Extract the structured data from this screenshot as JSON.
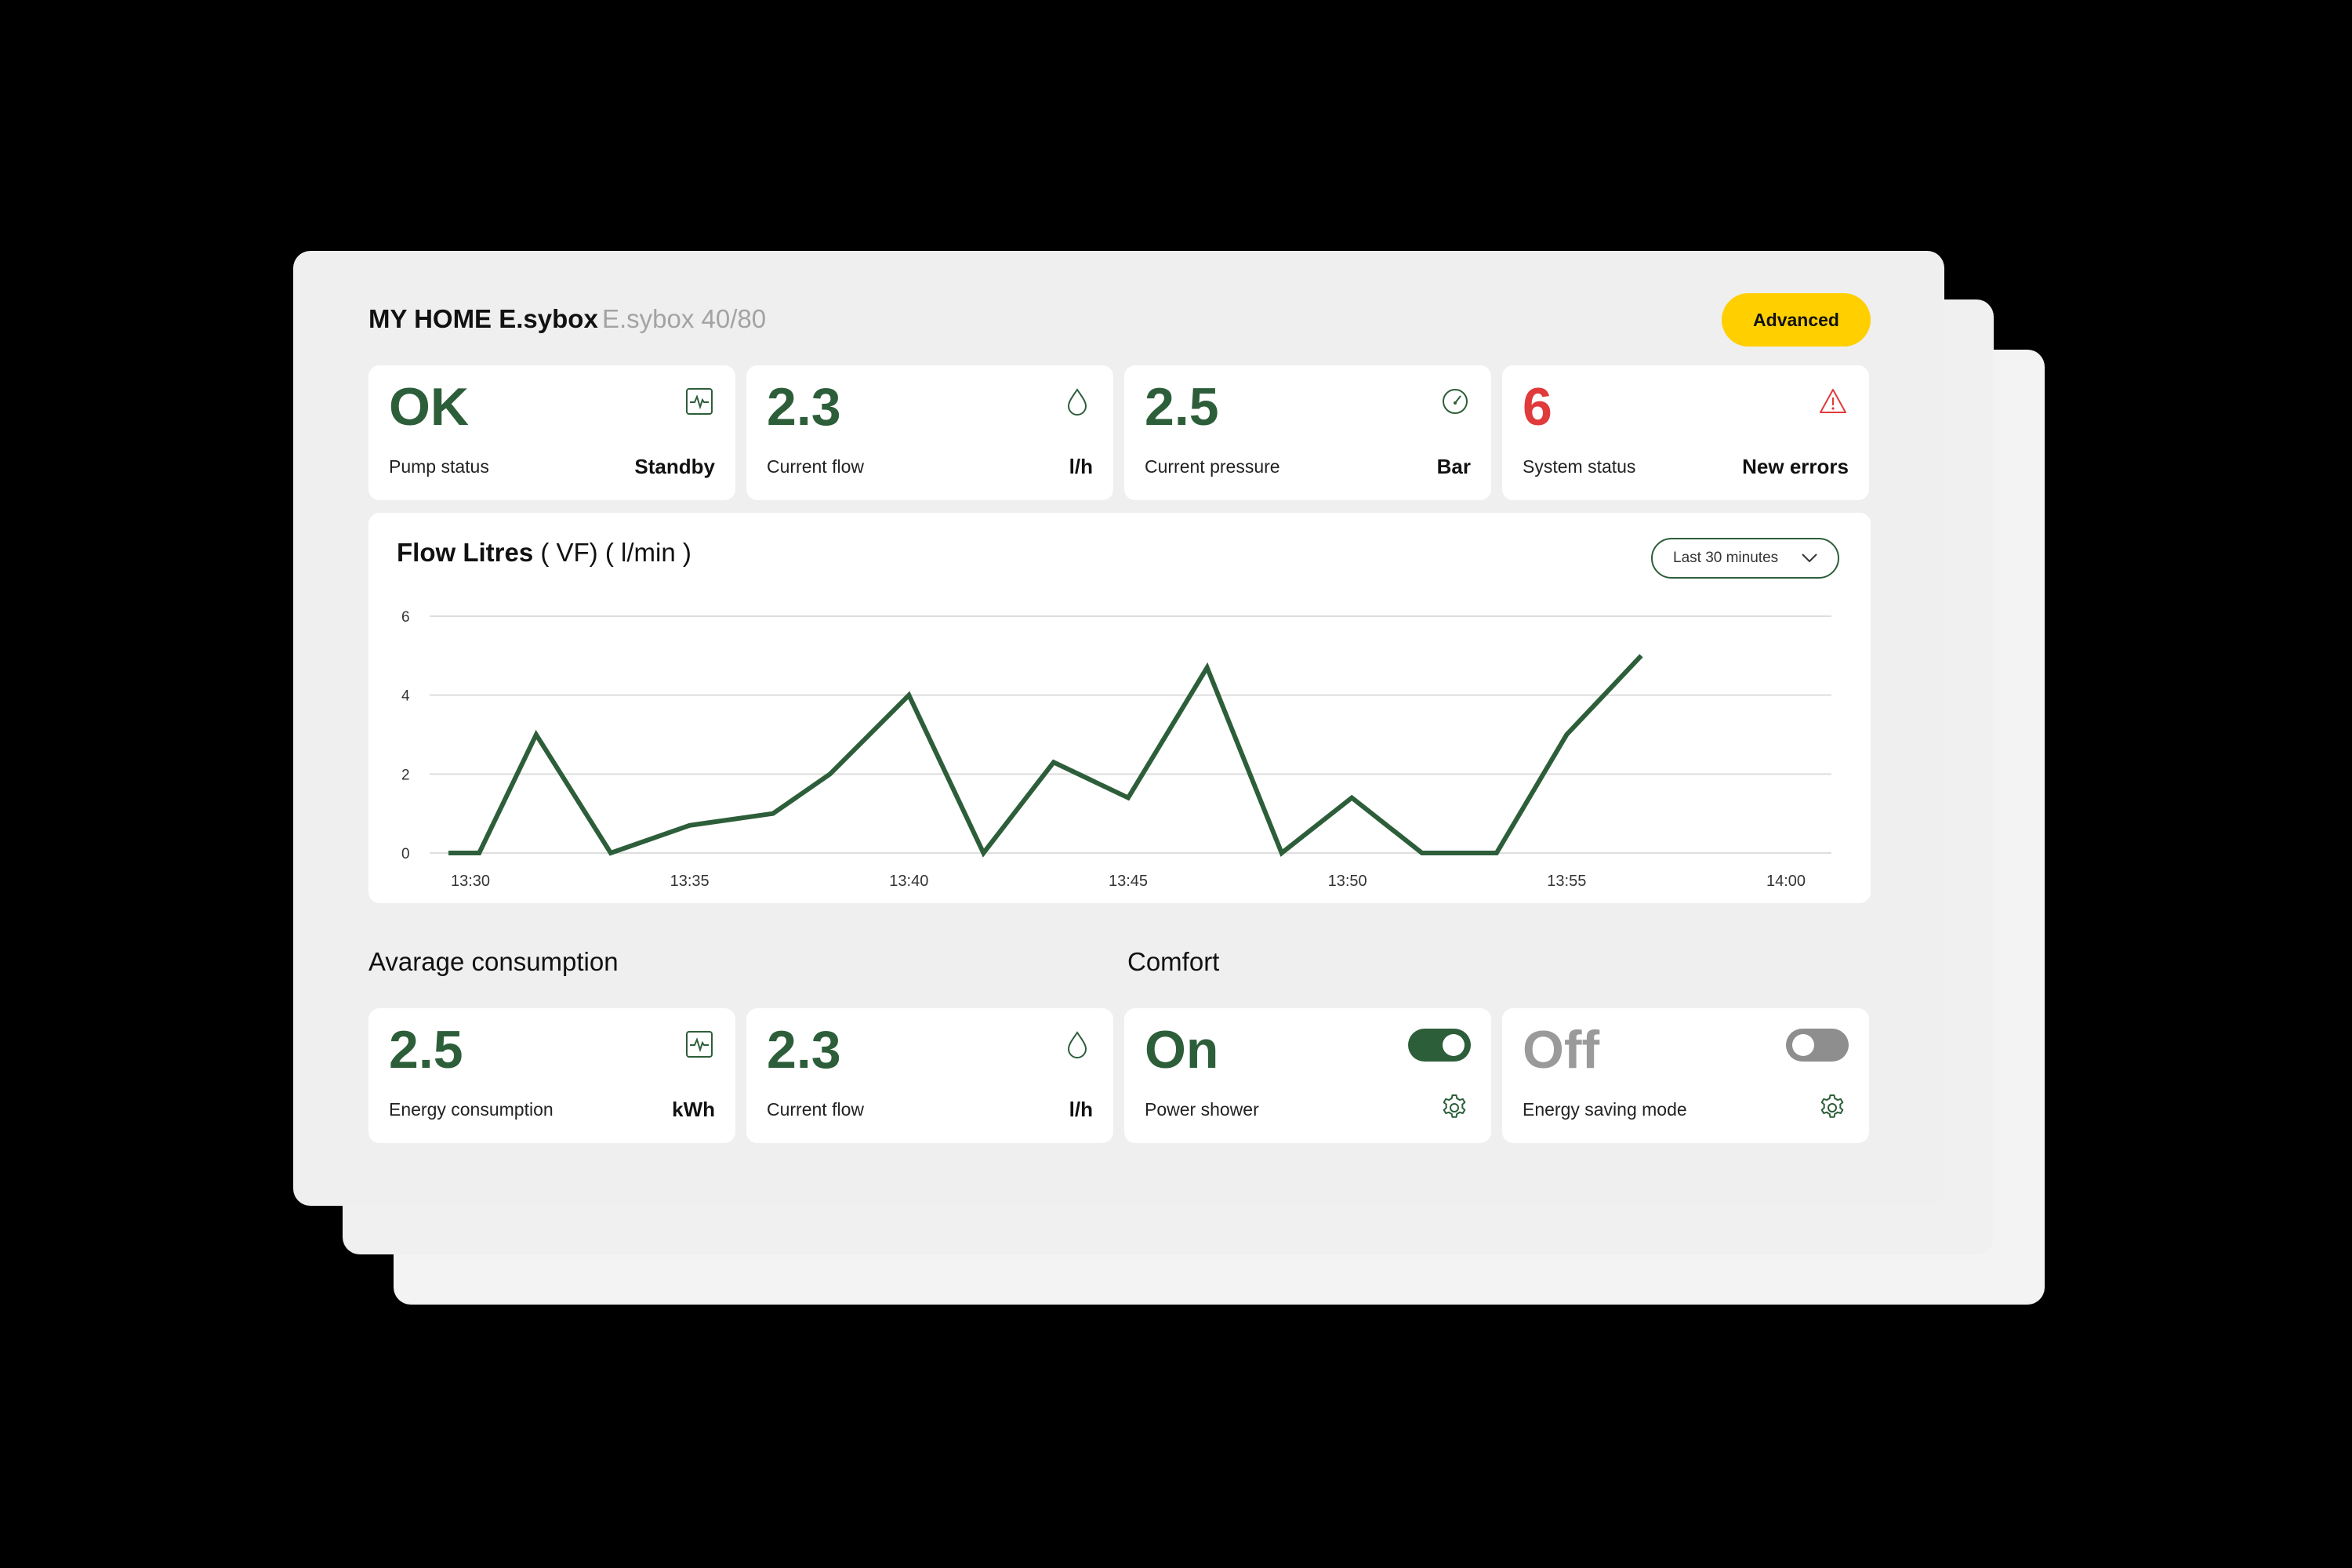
{
  "header": {
    "title": "MY HOME E.sybox",
    "subtitle": "E.sybox 40/80",
    "advanced_label": "Advanced"
  },
  "status_cards": [
    {
      "value": "OK",
      "label": "Pump status",
      "unit": "Standby",
      "icon": "activity-icon"
    },
    {
      "value": "2.3",
      "label": "Current flow",
      "unit": "l/h",
      "icon": "drop-icon"
    },
    {
      "value": "2.5",
      "label": "Current pressure",
      "unit": "Bar",
      "icon": "gauge-icon"
    },
    {
      "value": "6",
      "label": "System status",
      "unit": "New errors",
      "icon": "warning-icon"
    }
  ],
  "chart": {
    "title_bold": "Flow Litres",
    "title_rest": " ( VF) ( l/min )",
    "range_label": "Last 30 minutes"
  },
  "chart_data": {
    "type": "line",
    "title": "Flow Litres ( VF) ( l/min )",
    "x_ticks": [
      "13:30",
      "13:35",
      "13:40",
      "13:45",
      "13:50",
      "13:55",
      "14:00"
    ],
    "y_ticks": [
      "0",
      "2",
      "4",
      "6"
    ],
    "ylim": [
      0,
      6
    ],
    "xlim": [
      "13:30",
      "14:00"
    ],
    "grid": true,
    "series": [
      {
        "color": "#2d5e3a",
        "x": [
          "13:29.5",
          "13:30.2",
          "13:31.5",
          "13:33.2",
          "13:35",
          "13:36.9",
          "13:38.2",
          "13:40",
          "13:41.7",
          "13:43.3",
          "13:45",
          "13:46.8",
          "13:48.5",
          "13:50.1",
          "13:51.7",
          "13:53.4",
          "13:55",
          "13:56.7"
        ],
        "y": [
          0,
          0,
          3.0,
          0,
          0.7,
          1.0,
          2.0,
          4.0,
          0,
          2.3,
          1.4,
          4.7,
          0,
          1.4,
          0,
          0,
          3.0,
          5.0
        ]
      }
    ]
  },
  "consumption": {
    "title": "Avarage consumption",
    "cards": [
      {
        "value": "2.5",
        "label": "Energy consumption",
        "unit": "kWh",
        "icon": "activity-icon"
      },
      {
        "value": "2.3",
        "label": "Current flow",
        "unit": "l/h",
        "icon": "drop-icon"
      }
    ]
  },
  "comfort": {
    "title": "Comfort",
    "cards": [
      {
        "value": "On",
        "label": "Power shower",
        "toggle": "on"
      },
      {
        "value": "Off",
        "label": "Energy saving mode",
        "toggle": "off"
      }
    ]
  },
  "colors": {
    "accent": "#2d5e3a",
    "button": "#ffcf00",
    "error": "#e03a3a"
  }
}
